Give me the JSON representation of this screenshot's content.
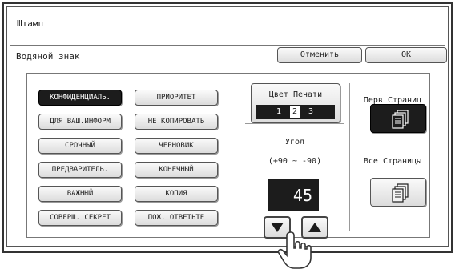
{
  "window": {
    "title": "Штамп"
  },
  "panel": {
    "title": "Водяной знак",
    "cancel_label": "Отменить",
    "ok_label": "OK"
  },
  "watermarks": {
    "left": [
      {
        "label": "КОНФИДЕНЦИАЛЬ.",
        "selected": true
      },
      {
        "label": "ДЛЯ ВАШ.ИНФОРМ",
        "selected": false
      },
      {
        "label": "СРОЧНЫЙ",
        "selected": false
      },
      {
        "label": "ПРЕДВАРИТЕЛЬ.",
        "selected": false
      },
      {
        "label": "ВАЖНЫЙ",
        "selected": false
      },
      {
        "label": "СОВЕРШ. СЕКРЕТ",
        "selected": false
      }
    ],
    "right": [
      {
        "label": "ПРИОРИТЕТ",
        "selected": false
      },
      {
        "label": "НЕ КОПИРОВАТЬ",
        "selected": false
      },
      {
        "label": "ЧЕРНОВИК",
        "selected": false
      },
      {
        "label": "КОНЕЧНЫЙ",
        "selected": false
      },
      {
        "label": "КОПИЯ",
        "selected": false
      },
      {
        "label": "ПОЖ. ОТВЕТЬТЕ",
        "selected": false
      }
    ]
  },
  "print_color": {
    "label": "Цвет Печати",
    "values": [
      "1",
      "2",
      "3"
    ],
    "selected": "2"
  },
  "angle": {
    "label": "Угол",
    "range": "(+90 ~ -90)",
    "value": "45"
  },
  "pages": {
    "first_page_label": "Перв Страниц",
    "all_pages_label": "Все Страницы",
    "selected": "first_page"
  },
  "icons": {
    "down": "triangle-down-icon",
    "up": "triangle-up-icon",
    "pages": "stacked-pages-icon",
    "hand": "pointing-hand-icon"
  },
  "colors": {
    "selected_bg": "#1c1c1c",
    "button_bg": "#e6e6e6",
    "border": "#555555"
  }
}
